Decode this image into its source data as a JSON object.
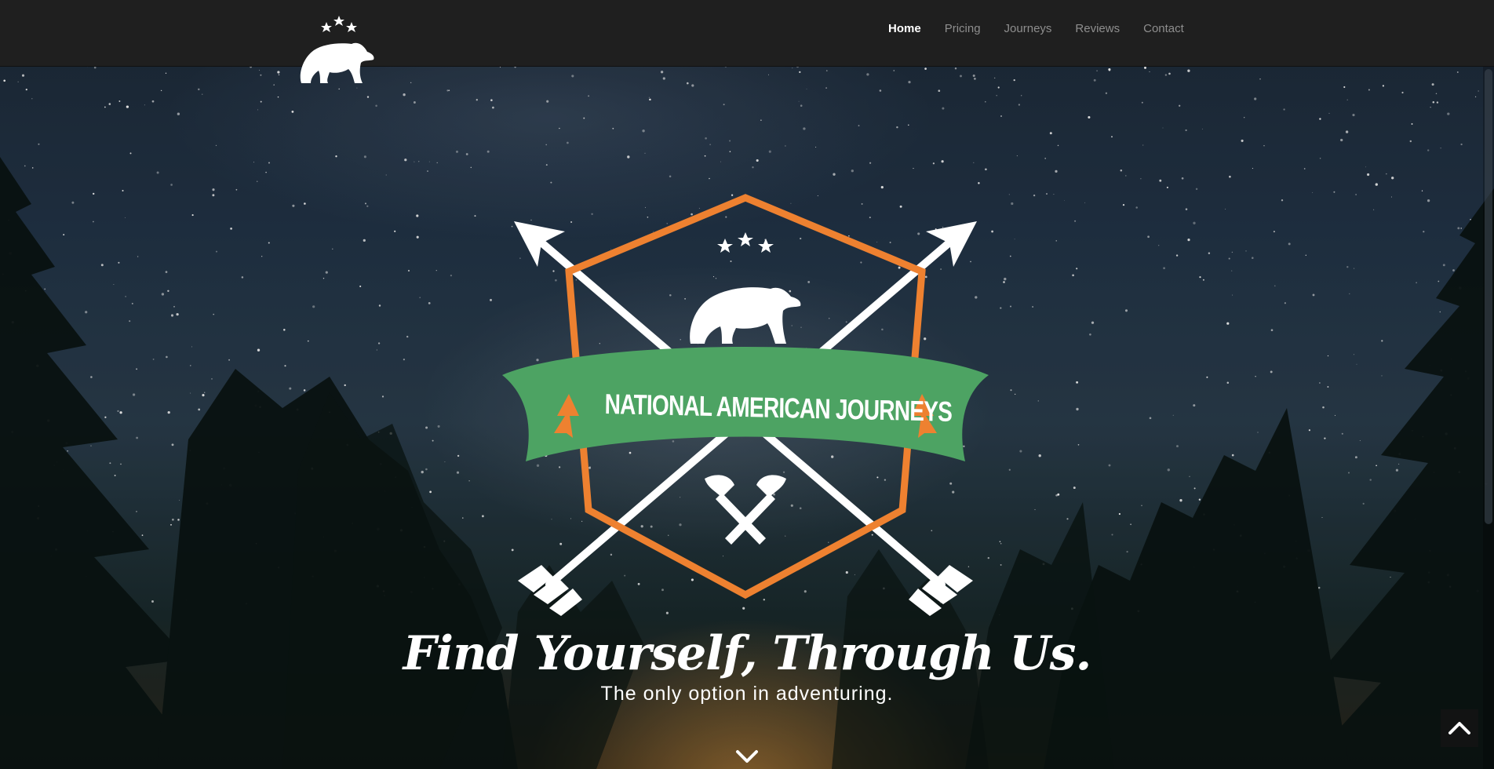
{
  "brand": {
    "logo_icon": "bear-with-stars-icon"
  },
  "nav": {
    "items": [
      {
        "label": "Home",
        "active": true
      },
      {
        "label": "Pricing",
        "active": false
      },
      {
        "label": "Journeys",
        "active": false
      },
      {
        "label": "Reviews",
        "active": false
      },
      {
        "label": "Contact",
        "active": false
      }
    ]
  },
  "hero": {
    "emblem_banner": "NATIONAL AMERICAN JOURNEYS",
    "headline": "Find Yourself, Through Us.",
    "subheadline": "The only option in adventuring.",
    "scroll_down_icon": "chevron-down-icon",
    "back_to_top_icon": "chevron-up-icon"
  },
  "colors": {
    "navbar_bg": "#1f1f1f",
    "emblem_orange": "#ee8130",
    "banner_green": "#4da363",
    "text_white": "#ffffff",
    "nav_inactive": "#8e8e8e"
  }
}
